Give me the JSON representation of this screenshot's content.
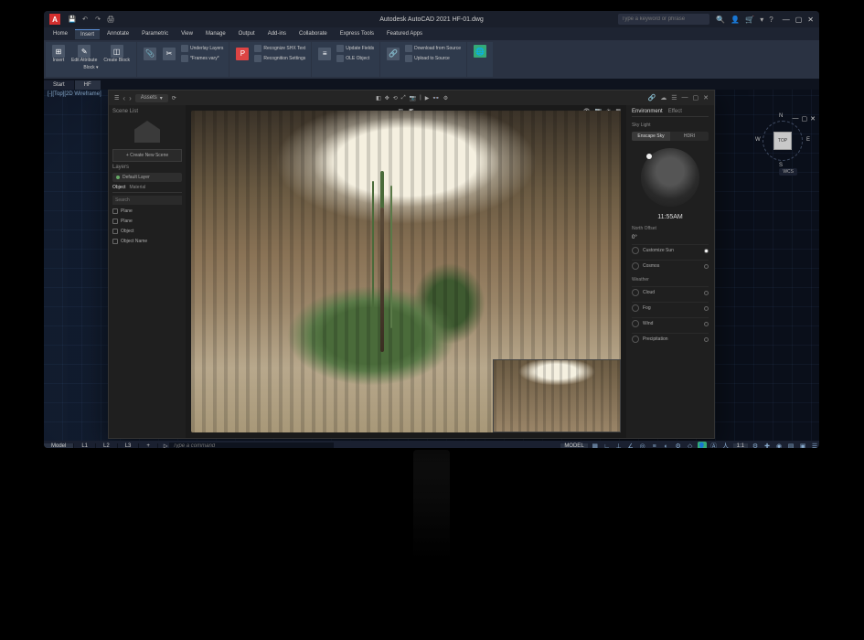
{
  "app": {
    "title": "Autodesk AutoCAD 2021   HF-01.dwg",
    "logo": "A"
  },
  "search": {
    "placeholder": "Type a keyword or phrase"
  },
  "menu_tabs": [
    "Home",
    "Insert",
    "Annotate",
    "Parametric",
    "View",
    "Manage",
    "Output",
    "Add-ins",
    "Collaborate",
    "Express Tools",
    "Featured Apps"
  ],
  "menu_active": "Insert",
  "ribbon": {
    "block": {
      "insert": "Insert",
      "edit_attr": "Edit\nAttribute",
      "create": "Create\nBlock",
      "panel": "Block ▾"
    },
    "ref": {
      "underlay": "Underlay Layers",
      "frames": "*Frames vary*"
    },
    "import": {
      "recognize": "Recognize SHX Text",
      "settings": "Recognition Settings"
    },
    "data": {
      "update": "Update Fields",
      "ole": "OLE Object"
    },
    "link": {
      "download": "Download from Source",
      "upload": "Upload to Source"
    }
  },
  "filetabs": {
    "start": "Start",
    "file": "HF"
  },
  "viewport_label": "[-][Top][2D Wireframe]",
  "navcube": {
    "face": "TOP",
    "n": "N",
    "s": "S",
    "e": "E",
    "w": "W",
    "wcs": "WCS"
  },
  "render": {
    "assets_btn": "Assets",
    "scene_list": "Scene List",
    "create_scene": "+ Create New Scene",
    "layers": "Layers",
    "default_layer": "Default Layer",
    "subtabs": [
      "Object",
      "Material"
    ],
    "search_placeholder": "Search",
    "tree": [
      "Plane",
      "Plane",
      "Object",
      "Object Name"
    ],
    "env_tabs": [
      "Environment",
      "Effect"
    ],
    "sky_label": "Sky Light",
    "sky_modes": [
      "Enscape Sky",
      "HDRI"
    ],
    "time": "11:55AM",
    "north_offset": "North Offset",
    "offset_val": "0°",
    "illum": "Customize Sun",
    "cosmos": "Cosmos",
    "weather": "Weather",
    "weather_items": [
      "Cloud",
      "Fog",
      "Wind",
      "Precipitation"
    ]
  },
  "cmd_placeholder": "Type a command",
  "status": {
    "tabs": [
      "Model",
      "L1",
      "L2",
      "L3"
    ],
    "model": "MODEL",
    "scale": "1:1"
  }
}
